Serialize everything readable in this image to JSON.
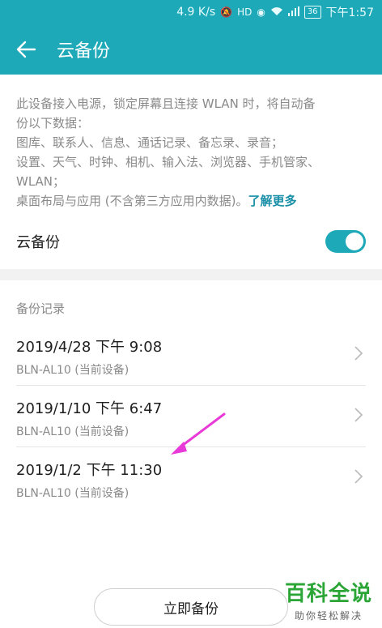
{
  "status_bar": {
    "speed": "4.9 K/s",
    "battery": "36",
    "time": "下午1:57"
  },
  "header": {
    "title": "云备份"
  },
  "description": {
    "lines": [
      "此设备接入电源，锁定屏幕且连接 WLAN 时，将自动备",
      "份以下数据：",
      "图库、联系人、信息、通话记录、备忘录、录音；",
      "设置、天气、时钟、相机、输入法、浏览器、手机管家、",
      "WLAN；",
      "桌面布局与应用 (不含第三方应用内数据)。"
    ],
    "learn_more": "了解更多"
  },
  "toggle": {
    "label": "云备份",
    "state": "on",
    "color": "#1ea9b8"
  },
  "records": {
    "title": "备份记录",
    "items": [
      {
        "date": "2019/4/28 下午 9:08",
        "device": "BLN-AL10 (当前设备)"
      },
      {
        "date": "2019/1/10 下午 6:47",
        "device": "BLN-AL10 (当前设备)"
      },
      {
        "date": "2019/1/2 下午 11:30",
        "device": "BLN-AL10 (当前设备)"
      }
    ]
  },
  "actions": {
    "backup_now": "立即备份"
  },
  "watermark": {
    "main": "百科全说",
    "sub": "助你轻松解决"
  },
  "icons": [
    "back-arrow-icon",
    "chevron-right-icon",
    "wifi-icon",
    "signal-icon",
    "eye-icon",
    "mute-icon"
  ],
  "colors": {
    "accent": "#1ea9b8",
    "link": "#1a8fa8",
    "annotation_arrow": "#e83ad8",
    "watermark": "#2aa536"
  }
}
